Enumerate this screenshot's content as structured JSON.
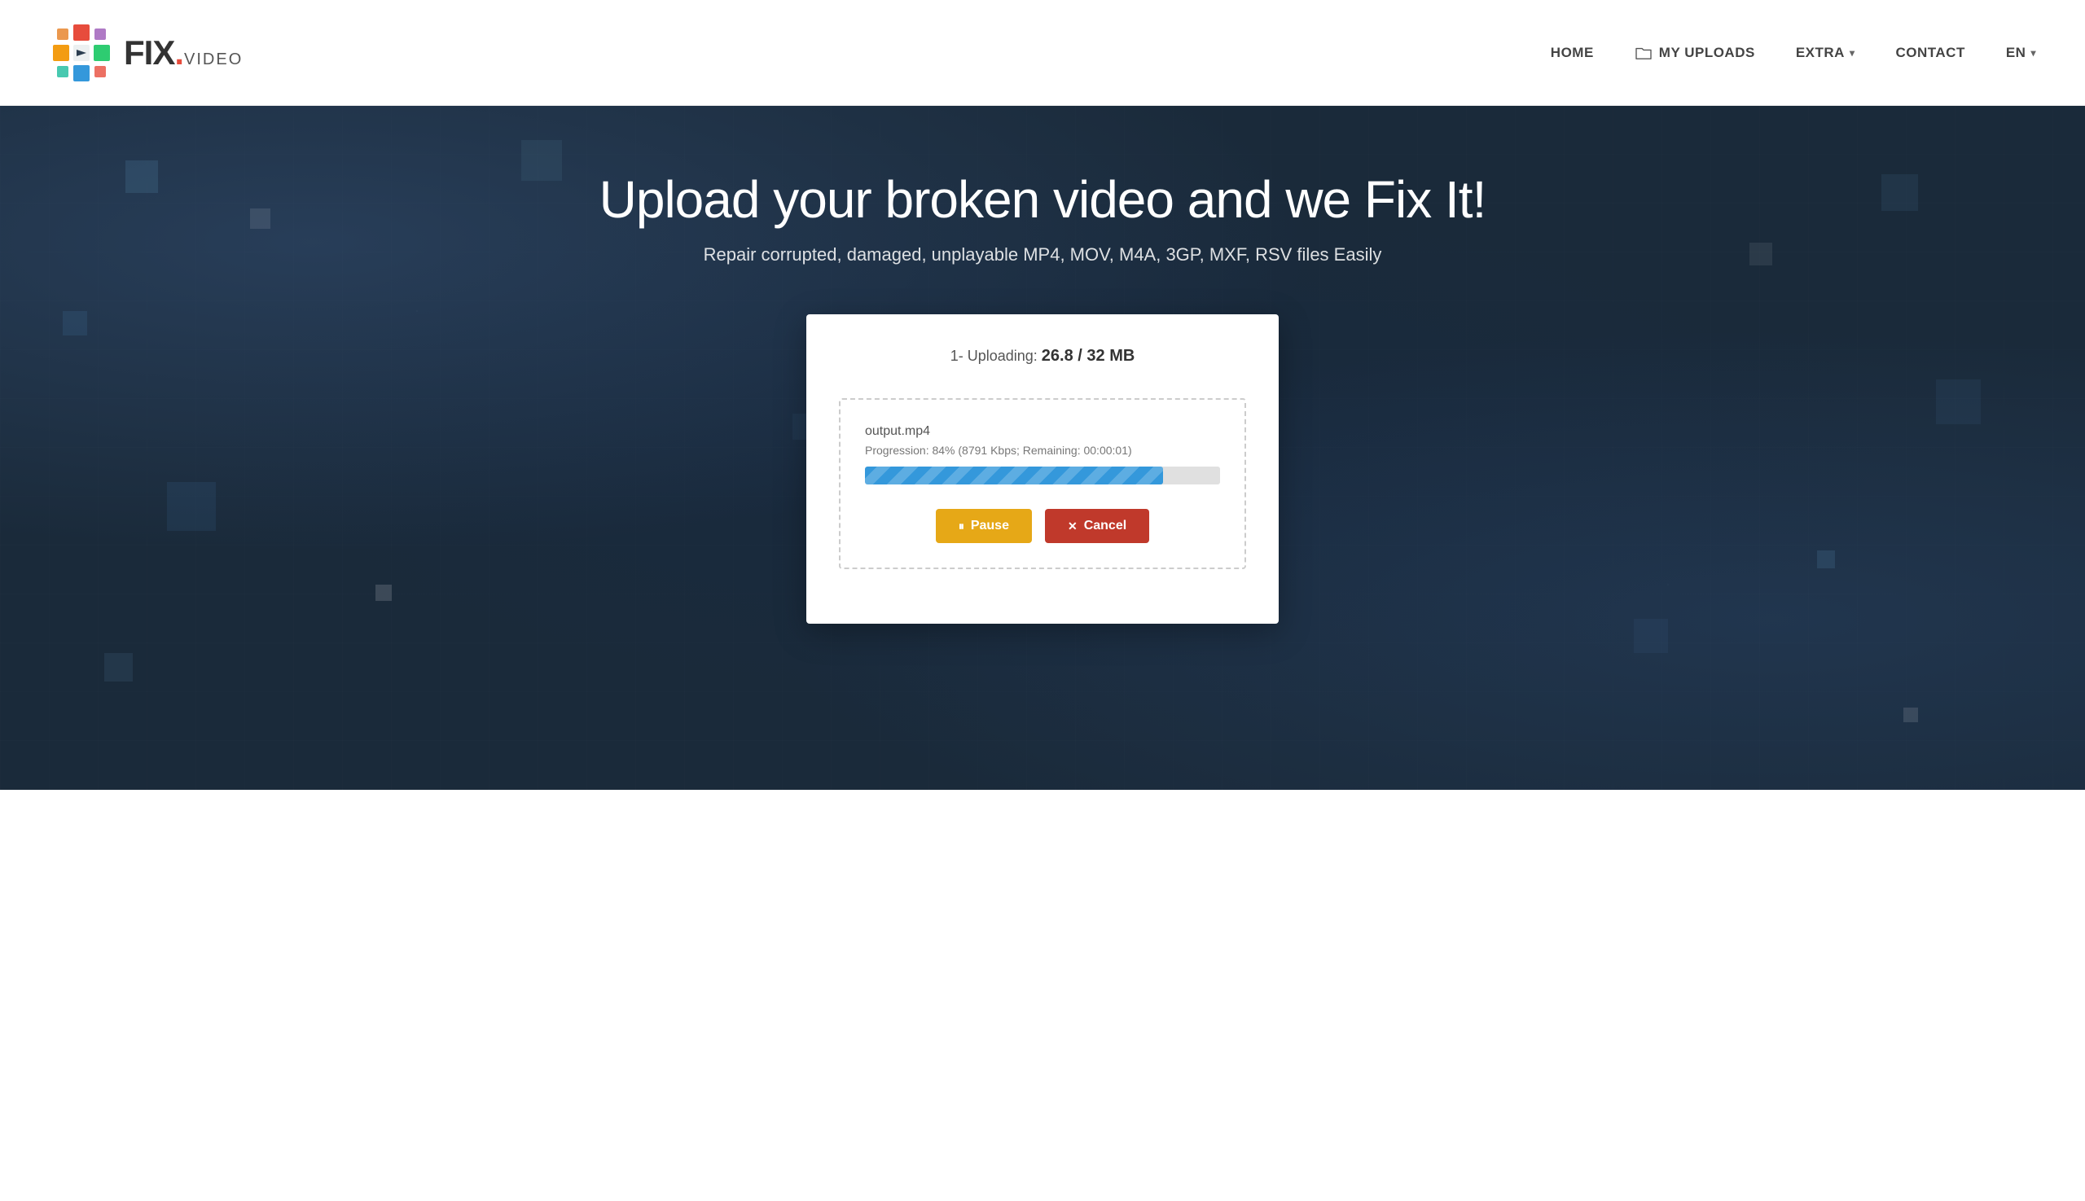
{
  "header": {
    "logo": {
      "fix_text": "FIX",
      "dot": ".",
      "video_text": "VIDEO"
    },
    "nav": {
      "home_label": "HOME",
      "uploads_label": "MY UPLOADS",
      "extra_label": "EXTRA",
      "contact_label": "CONTACT",
      "lang_label": "EN"
    }
  },
  "hero": {
    "title": "Upload your broken video and we Fix It!",
    "subtitle": "Repair corrupted, damaged, unplayable MP4, MOV, M4A, 3GP, MXF, RSV files Easily"
  },
  "upload_card": {
    "status_prefix": "1- Uploading: ",
    "status_current": "26.8",
    "status_separator": " / ",
    "status_total": "32 MB",
    "file_name": "output.mp4",
    "progression_label": "Progression: 84% (8791 Kbps; Remaining: 00:00:01)",
    "progress_percent": 84,
    "pause_label": "Pause",
    "cancel_label": "Cancel",
    "pause_icon": "⏸",
    "cancel_icon": "✕"
  }
}
